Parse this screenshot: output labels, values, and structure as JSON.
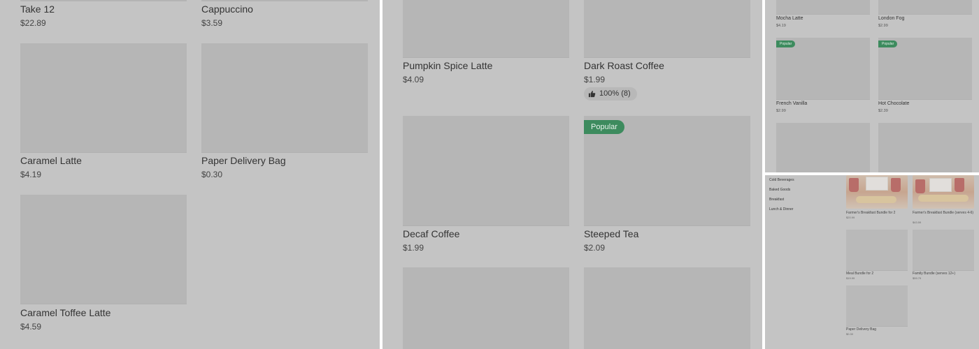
{
  "panel1": {
    "items": [
      {
        "name": "Take 12",
        "price": "$22.89"
      },
      {
        "name": "Cappuccino",
        "price": "$3.59"
      },
      {
        "name": "Caramel Latte",
        "price": "$4.19"
      },
      {
        "name": "Paper Delivery Bag",
        "price": "$0.30"
      },
      {
        "name": "Caramel Toffee Latte",
        "price": "$4.59"
      }
    ]
  },
  "panel2": {
    "items": [
      {
        "name": "Pumpkin Spice Latte",
        "price": "$4.09"
      },
      {
        "name": "Dark Roast Coffee",
        "price": "$1.99",
        "rating": "100% (8)"
      },
      {
        "name": "Decaf Coffee",
        "price": "$1.99"
      },
      {
        "name": "Steeped Tea",
        "price": "$2.09",
        "badge": "Popular"
      }
    ]
  },
  "panel3": {
    "items": [
      {
        "name": "Mocha Latte",
        "price": "$4.19"
      },
      {
        "name": "London Fog",
        "price": "$2.99"
      },
      {
        "name": "French Vanilla",
        "price": "$2.99",
        "badge": "Popular"
      },
      {
        "name": "Hot Chocolate",
        "price": "$2.39",
        "badge": "Popular"
      }
    ]
  },
  "panel4": {
    "nav": [
      "Cold Beverages",
      "Baked Goods",
      "Breakfast",
      "Lunch & Dinner"
    ],
    "items": [
      {
        "name": "Farmer's Breakfast Bundle for 2",
        "price": "$20.99"
      },
      {
        "name": "Farmer's Breakfast Bundle (serves 4-6)",
        "price": "$43.59"
      },
      {
        "name": "Meal Bundle for 2",
        "price": "$19.99"
      },
      {
        "name": "Family Bundle (serves 12+)",
        "price": "$59.79"
      },
      {
        "name": "Paper Delivery Bag",
        "price": "$0.30"
      }
    ]
  },
  "colors": {
    "overlay": "#c4c4c4",
    "badge": "#3d8b5e",
    "image_placeholder": "#b6b6b6"
  }
}
